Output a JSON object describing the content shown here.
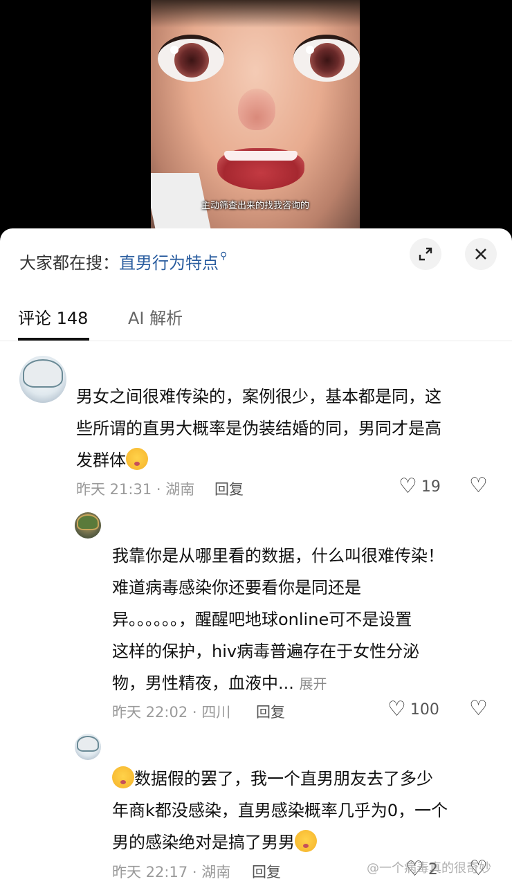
{
  "video": {
    "caption": "主动筛查出来的找我咨询的"
  },
  "search": {
    "prefix": "大家都在搜：",
    "query": "直男行为特点"
  },
  "tabs": [
    {
      "label": "评论 148"
    },
    {
      "label": "AI 解析"
    }
  ],
  "comments": [
    {
      "text_lines": [
        "男女之间很难传染的，案例很少，基本都是同，这",
        "些所谓的直男大概率是伪装结婚的同，男同才是高",
        "发群体"
      ],
      "time": "昨天 21:31 · 湖南",
      "reply": "回复",
      "likes": "19"
    },
    {
      "text_lines": [
        "我靠你是从哪里看的数据，什么叫很难传染！",
        "难道病毒感染你还要看你是同还是",
        "异。。。。。。，醒醒吧地球online可不是设置",
        "这样的保护，hiv病毒普遍存在于女性分泌",
        "物，男性精夜，血液中..."
      ],
      "expand": "展开",
      "time": "昨天 22:02 · 四川",
      "reply": "回复",
      "likes": "100"
    },
    {
      "text_lines": [
        "数据假的罢了，我一个直男朋友去了多少",
        "年商k都没感染，直男感染概率几乎为0，一个",
        "男的感染绝对是搞了男男"
      ],
      "time": "昨天 22:17 · 湖南",
      "reply": "回复",
      "likes": "2"
    }
  ],
  "watermark": "@一个病毒真的很奇妙"
}
